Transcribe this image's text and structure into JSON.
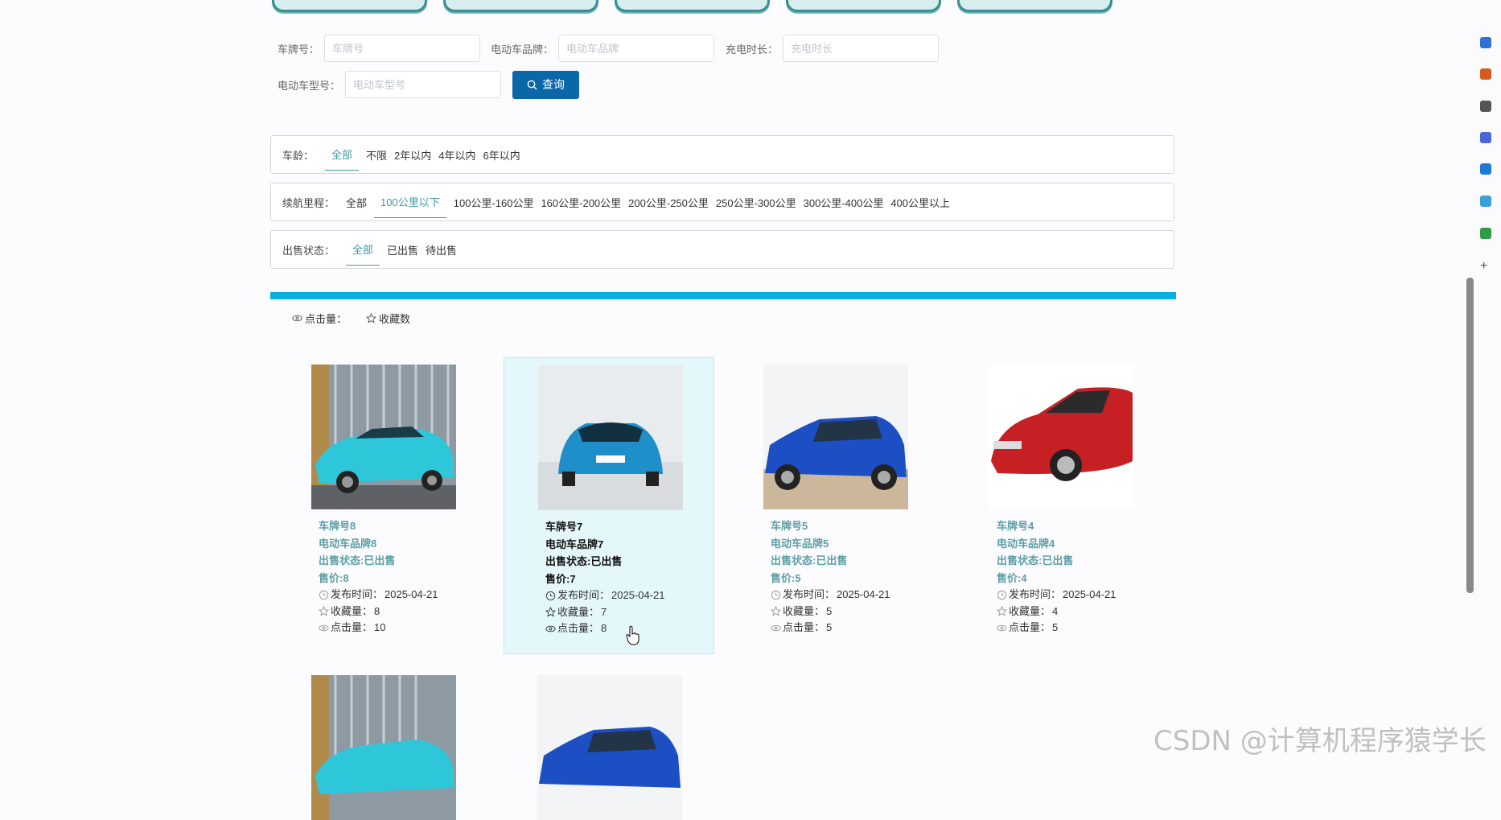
{
  "search": {
    "plate_label": "车牌号：",
    "plate_placeholder": "车牌号",
    "brand_label": "电动车品牌：",
    "brand_placeholder": "电动车品牌",
    "charge_label": "充电时长：",
    "charge_placeholder": "充电时长",
    "model_label": "电动车型号：",
    "model_placeholder": "电动车型号",
    "query_label": "查询"
  },
  "filters": {
    "age": {
      "label": "车龄：",
      "options": [
        "全部",
        "不限",
        "2年以内",
        "4年以内",
        "6年以内"
      ],
      "active": 0
    },
    "range": {
      "label": "续航里程：",
      "options": [
        "全部",
        "100公里以下",
        "100公里-160公里",
        "160公里-200公里",
        "200公里-250公里",
        "250公里-300公里",
        "300公里-400公里",
        "400公里以上"
      ],
      "active": 1
    },
    "status": {
      "label": "出售状态：",
      "options": [
        "全部",
        "已出售",
        "待出售"
      ],
      "active": 0
    }
  },
  "sort": {
    "clicks_label": "点击量：",
    "favorites_label": "收藏数"
  },
  "cards": [
    {
      "plate": "车牌号8",
      "brand": "电动车品牌8",
      "status": "出售状态:已出售",
      "price": "售价:8",
      "date_label": "发布时间：",
      "date": "2025-04-21",
      "fav_label": "收藏量：",
      "fav": "8",
      "click_label": "点击量：",
      "clicks": "10",
      "image": "cyan-suv"
    },
    {
      "plate": "车牌号7",
      "brand": "电动车品牌7",
      "status": "出售状态:已出售",
      "price": "售价:7",
      "date_label": "发布时间：",
      "date": "2025-04-21",
      "fav_label": "收藏量：",
      "fav": "7",
      "click_label": "点击量：",
      "clicks": "8",
      "image": "blue-sedan-front"
    },
    {
      "plate": "车牌号5",
      "brand": "电动车品牌5",
      "status": "出售状态:已出售",
      "price": "售价:5",
      "date_label": "发布时间：",
      "date": "2025-04-21",
      "fav_label": "收藏量：",
      "fav": "5",
      "click_label": "点击量：",
      "clicks": "5",
      "image": "blue-suv-side"
    },
    {
      "plate": "车牌号4",
      "brand": "电动车品牌4",
      "status": "出售状态:已出售",
      "price": "售价:4",
      "date_label": "发布时间：",
      "date": "2025-04-21",
      "fav_label": "收藏量：",
      "fav": "4",
      "click_label": "点击量：",
      "clicks": "5",
      "image": "red-hatchback"
    }
  ],
  "watermark": "CSDN @计算机程序猿学长",
  "colors": {
    "accent": "#3a9aa1",
    "query_button": "#0a67a8",
    "bar": "#06b0e0",
    "hover_bg": "#e4f8fc"
  }
}
